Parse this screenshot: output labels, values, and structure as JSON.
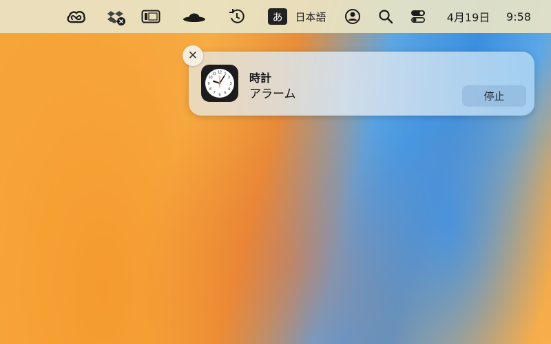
{
  "menubar": {
    "icons": [
      "creative-cloud-icon",
      "dropbox-icon",
      "window-icon",
      "hat-icon",
      "time-machine-icon",
      "user-icon",
      "search-icon",
      "control-center-icon"
    ],
    "input_mode_glyph": "あ",
    "input_source": "日本語",
    "date": "4月19日",
    "time": "9:58"
  },
  "notification": {
    "app_name": "時計",
    "body": "アラーム",
    "action_label": "停止",
    "close_glyph": "✕"
  }
}
